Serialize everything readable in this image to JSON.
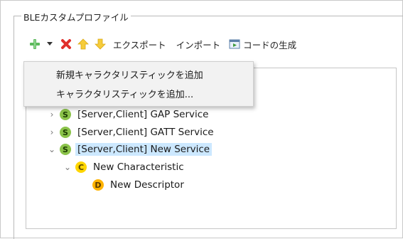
{
  "group": {
    "title": "BLEカスタムプロファイル"
  },
  "toolbar": {
    "export_label": "エクスポート",
    "import_label": "インポート",
    "generate_label": "コードの生成",
    "colors": {
      "add": "#4caf50",
      "delete": "#e53935",
      "up": "#f5c518",
      "down": "#f5c518"
    }
  },
  "menu": {
    "items": [
      {
        "label": "新規キャラクタリスティックを追加"
      },
      {
        "label": "キャラクタリスティックを追加..."
      }
    ]
  },
  "tree": {
    "items": [
      {
        "icon_letter": "S",
        "label": "[Server,Client] GAP Service",
        "expanded": false,
        "selected": false
      },
      {
        "icon_letter": "S",
        "label": "[Server,Client] GATT Service",
        "expanded": false,
        "selected": false
      },
      {
        "icon_letter": "S",
        "label": "[Server,Client] New Service",
        "expanded": true,
        "selected": true
      },
      {
        "icon_letter": "C",
        "label": "New Characteristic",
        "expanded": true,
        "selected": false
      },
      {
        "icon_letter": "D",
        "label": "New Descriptor",
        "expanded": false,
        "selected": false
      }
    ],
    "icon_colors": {
      "S": "#8bc34a",
      "C": "#ffd600",
      "D": "#ffb300"
    }
  }
}
